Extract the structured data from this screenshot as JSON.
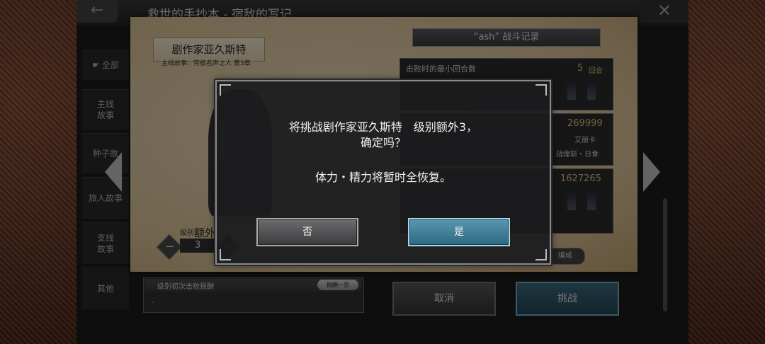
{
  "header": {
    "title": "救世的手抄本 - 宿敌的写记",
    "back_icon": "←",
    "close_icon": "✕"
  },
  "menu": {
    "all_label": "全部",
    "items": [
      "主线\n故事",
      "种子故",
      "旅人故事",
      "支线\n故事",
      "其他"
    ]
  },
  "boss": {
    "name": "剧作家亚久斯特",
    "subtitle": "主线故事：穷极名声之人 第3章"
  },
  "level": {
    "label": "级别:",
    "name": "额外",
    "value": "3"
  },
  "record": {
    "title": "“ash” 战斗记录",
    "min_turns_label": "击败时的最小回合数",
    "min_turns_value": "5",
    "min_turns_unit": "回合",
    "max_damage_value": "269999",
    "max_damage_character": "艾丽卡",
    "max_damage_skill": "战煌斩・日食",
    "total_damage_value": "1627265"
  },
  "reward": {
    "title": "级别初次击败报酬",
    "list_button": "报酬一览",
    "empty_text": "-"
  },
  "edit_button": "编成",
  "bottom": {
    "cancel": "取消",
    "challenge": "挑战"
  },
  "dialog": {
    "message_line1": "将挑战剧作家亚久斯特　级别额外3，",
    "message_line2": "确定吗？",
    "sub_message": "体力・精力将暂时全恢复。",
    "no": "否",
    "yes": "是"
  },
  "colors": {
    "parchment": "#ead7b0",
    "yes_button": "#3f7f99",
    "no_button": "#555557"
  }
}
